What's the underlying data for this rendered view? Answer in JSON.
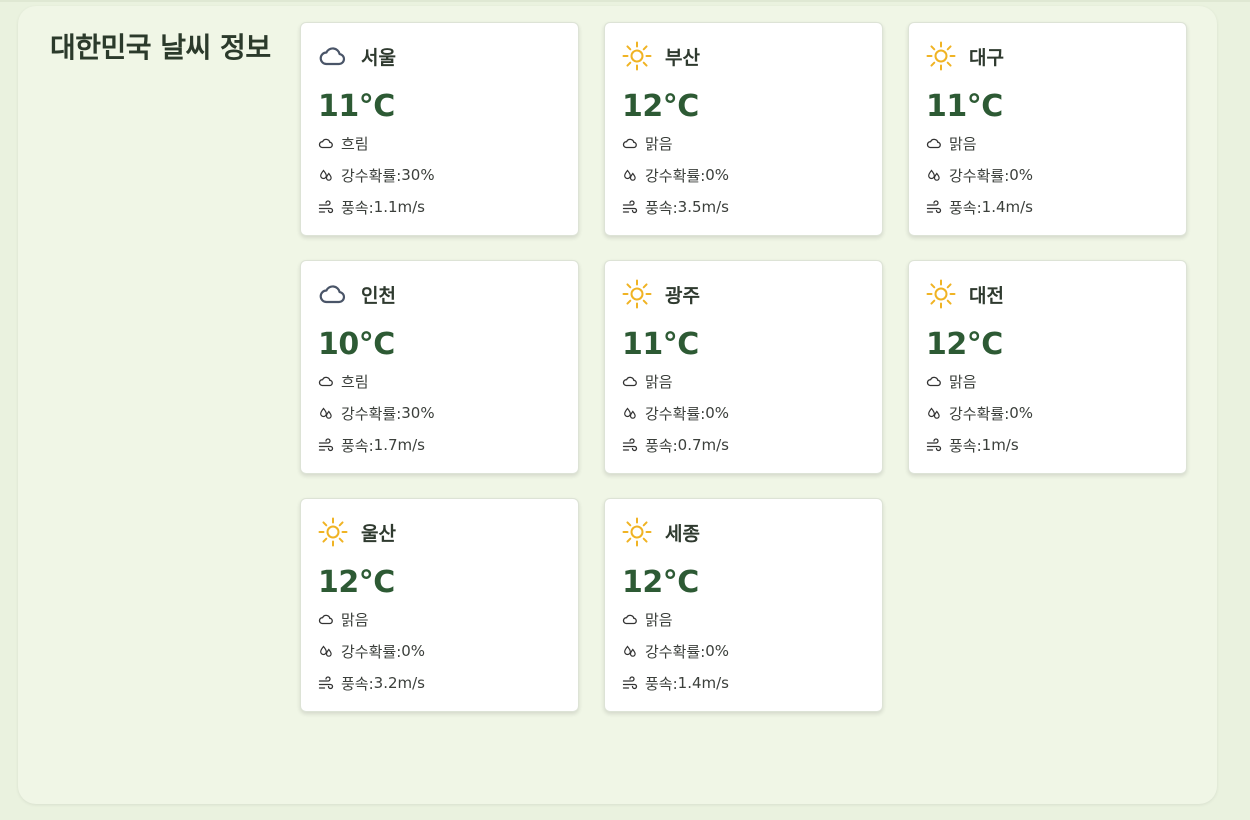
{
  "page": {
    "title": "대한민국 날씨 정보"
  },
  "labels": {
    "rain_prefix": "강수확률: ",
    "wind_prefix": "풍속: "
  },
  "colors": {
    "temperature": "#2d5a34",
    "sun": "#f0b323",
    "cloud": "#4a5568"
  },
  "cities": [
    {
      "name": "서울",
      "icon": "cloud-icon",
      "temp": "11°C",
      "condition": "흐림",
      "rain": "30%",
      "wind": "1.1m/s"
    },
    {
      "name": "부산",
      "icon": "sun-icon",
      "temp": "12°C",
      "condition": "맑음",
      "rain": "0%",
      "wind": "3.5m/s"
    },
    {
      "name": "대구",
      "icon": "sun-icon",
      "temp": "11°C",
      "condition": "맑음",
      "rain": "0%",
      "wind": "1.4m/s"
    },
    {
      "name": "인천",
      "icon": "cloud-icon",
      "temp": "10°C",
      "condition": "흐림",
      "rain": "30%",
      "wind": "1.7m/s"
    },
    {
      "name": "광주",
      "icon": "sun-icon",
      "temp": "11°C",
      "condition": "맑음",
      "rain": "0%",
      "wind": "0.7m/s"
    },
    {
      "name": "대전",
      "icon": "sun-icon",
      "temp": "12°C",
      "condition": "맑음",
      "rain": "0%",
      "wind": "1m/s"
    },
    {
      "name": "울산",
      "icon": "sun-icon",
      "temp": "12°C",
      "condition": "맑음",
      "rain": "0%",
      "wind": "3.2m/s"
    },
    {
      "name": "세종",
      "icon": "sun-icon",
      "temp": "12°C",
      "condition": "맑음",
      "rain": "0%",
      "wind": "1.4m/s"
    }
  ]
}
